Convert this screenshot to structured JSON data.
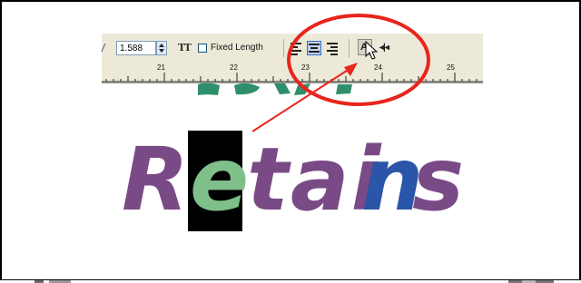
{
  "toolbar": {
    "spin_value": "1.588",
    "fixed_length_label": "Fixed Length",
    "tt_icon_text": "TT",
    "icons": {
      "spin": "spin-updown-icon",
      "text-fit": "text-fit-icon",
      "align-left": "align-left-icon",
      "align-center": "align-center-icon",
      "align-right": "align-right-icon",
      "text-tool": "text-tool-icon",
      "text-extra": "text-extra-icon"
    }
  },
  "ruler": {
    "labels": [
      "21",
      "22",
      "23",
      "24",
      "25"
    ]
  },
  "artwork": {
    "top_fragment": "ToXT",
    "letters": [
      "R",
      "e",
      "tai",
      "n",
      "s"
    ],
    "colors": {
      "purple": "#7a4a86",
      "green": "#7fbf8a",
      "blue": "#2a55a8",
      "teal": "#2e8f6a",
      "highlight": "#000000",
      "annotation": "#e8251d"
    }
  }
}
